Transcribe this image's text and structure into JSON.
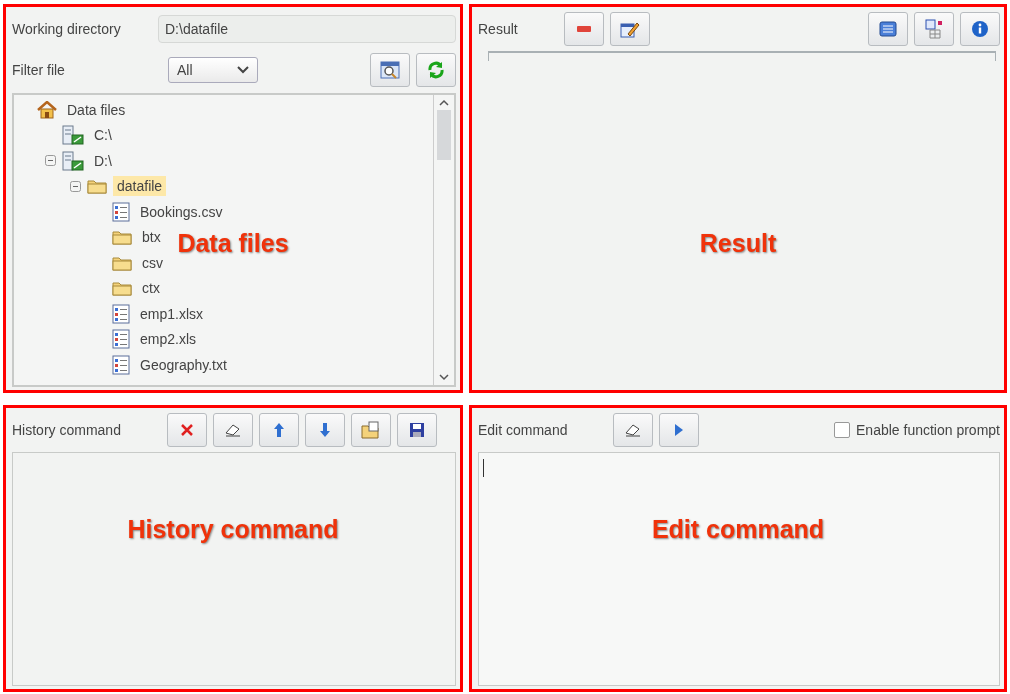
{
  "data_files_panel": {
    "annotation": "Data files",
    "working_directory": {
      "label": "Working directory",
      "value": "D:\\datafile"
    },
    "filter": {
      "label": "Filter file",
      "value": "All"
    },
    "tree": [
      {
        "label": "Data files",
        "kind": "home",
        "selected": false,
        "children": [
          {
            "label": "C:\\",
            "kind": "drive",
            "selected": false
          },
          {
            "label": "D:\\",
            "kind": "drive",
            "expanded": true,
            "selected": false,
            "children": [
              {
                "label": "datafile",
                "kind": "folder",
                "expanded": true,
                "selected": true,
                "children": [
                  {
                    "label": "Bookings.csv",
                    "kind": "file",
                    "selected": false
                  },
                  {
                    "label": "btx",
                    "kind": "folder",
                    "selected": false
                  },
                  {
                    "label": "csv",
                    "kind": "folder",
                    "selected": false
                  },
                  {
                    "label": "ctx",
                    "kind": "folder",
                    "selected": false
                  },
                  {
                    "label": "emp1.xlsx",
                    "kind": "file",
                    "selected": false
                  },
                  {
                    "label": "emp2.xls",
                    "kind": "file",
                    "selected": false
                  },
                  {
                    "label": "Geography.txt",
                    "kind": "file",
                    "selected": false
                  }
                ]
              }
            ]
          }
        ]
      }
    ]
  },
  "result_panel": {
    "annotation": "Result",
    "title": "Result"
  },
  "history_panel": {
    "annotation": "History command",
    "title": "History command"
  },
  "edit_panel": {
    "annotation": "Edit command",
    "title": "Edit command",
    "function_prompt": {
      "label": "Enable function prompt",
      "checked": false
    }
  }
}
